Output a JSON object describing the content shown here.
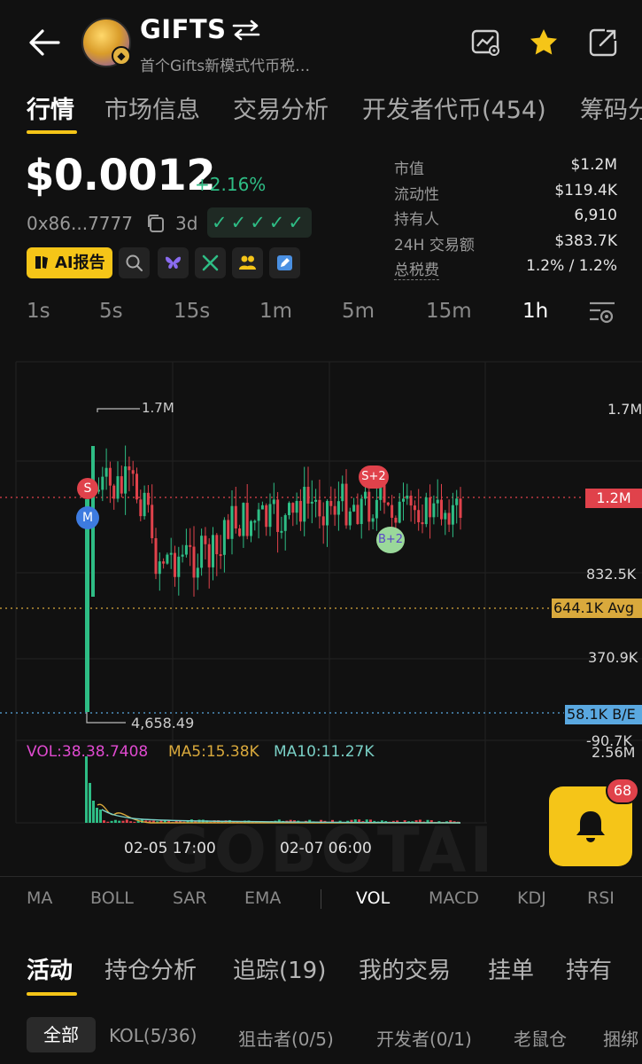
{
  "header": {
    "token_name": "GIFTS",
    "token_desc": "首个Gifts新模式代币税…"
  },
  "main_tabs": [
    {
      "label": "行情",
      "active": true
    },
    {
      "label": "市场信息"
    },
    {
      "label": "交易分析"
    },
    {
      "label": "开发者代币(454)"
    },
    {
      "label": "筹码分"
    }
  ],
  "price": {
    "value": "$0.0012",
    "change": "+2.16%",
    "address": "0x86...7777",
    "age": "3d",
    "checks": "✓✓✓✓✓"
  },
  "ai_report_label": "AI报告",
  "stats": [
    {
      "label": "市值",
      "value": "$1.2M"
    },
    {
      "label": "流动性",
      "value": "$119.4K"
    },
    {
      "label": "持有人",
      "value": "6,910"
    },
    {
      "label": "24H 交易额",
      "value": "$383.7K"
    },
    {
      "label": "总税费",
      "value": "1.2% / 1.2%"
    }
  ],
  "intervals": [
    "1s",
    "5s",
    "15s",
    "1m",
    "5m",
    "15m",
    "1h"
  ],
  "active_interval": "1h",
  "chart_data": {
    "type": "candlestick",
    "y_axis_labels": [
      "1.7M",
      "1.2M",
      "832.5K",
      "370.9K",
      "-90.7K",
      "2.56M"
    ],
    "current_marker": "1.2M",
    "avg_marker": "644.1K Avg",
    "be_marker": "58.1K B/E",
    "high_annotation": "1.7M",
    "low_annotation": "4,658.49",
    "x_labels": [
      "02-05 17:00",
      "02-07 06:00"
    ],
    "trade_markers": [
      "S",
      "M",
      "S+2",
      "B+2"
    ],
    "watermark": "GOBOTAI",
    "volume_legend": {
      "vol": "VOL:38.38.7408",
      "ma5": "MA5:15.38K",
      "ma10": "MA10:11.27K"
    },
    "colors": {
      "up": "#2ebd85",
      "down": "#e0424b",
      "ma5": "#d9a93c",
      "ma10": "#7ad0c6",
      "vol": "#e04ad0"
    }
  },
  "notifications": {
    "count": "68"
  },
  "indicators": [
    "MA",
    "BOLL",
    "SAR",
    "EMA",
    "VOL",
    "MACD",
    "KDJ",
    "RSI"
  ],
  "active_indicator": "VOL",
  "activity_tabs": [
    "活动",
    "持仓分析",
    "追踪(19)",
    "我的交易",
    "挂单",
    "持有"
  ],
  "filters": [
    "全部",
    "KOL(5/36)",
    "狙击者(0/5)",
    "开发者(0/1)",
    "老鼠仓",
    "捆绑"
  ]
}
